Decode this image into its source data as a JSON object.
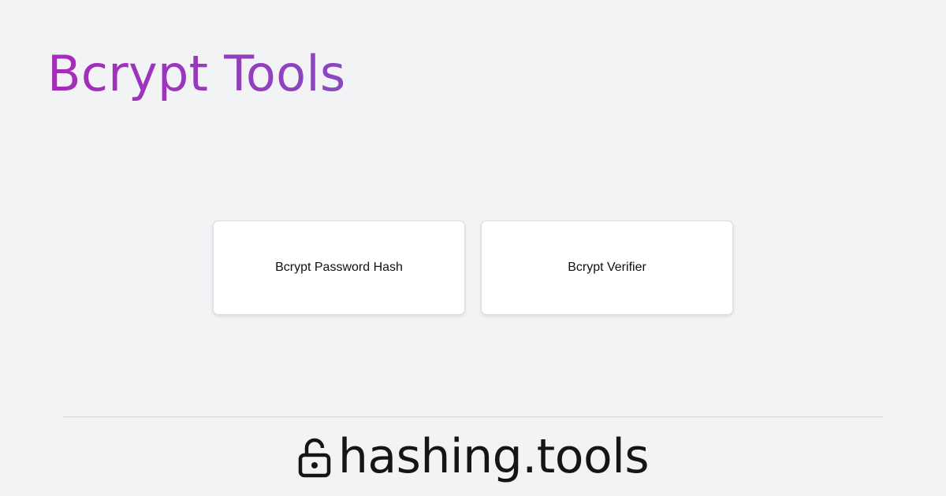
{
  "header": {
    "title": "Bcrypt Tools",
    "title_gradient": [
      "#a62bb8",
      "#8a47c2"
    ]
  },
  "cards": [
    {
      "label": "Bcrypt Password Hash"
    },
    {
      "label": "Bcrypt Verifier"
    }
  ],
  "footer": {
    "icon": "unlocked-padlock-icon",
    "brand": "hashing.tools"
  },
  "colors": {
    "background": "#f2f3f5",
    "card_background": "#ffffff",
    "text": "#151515"
  }
}
